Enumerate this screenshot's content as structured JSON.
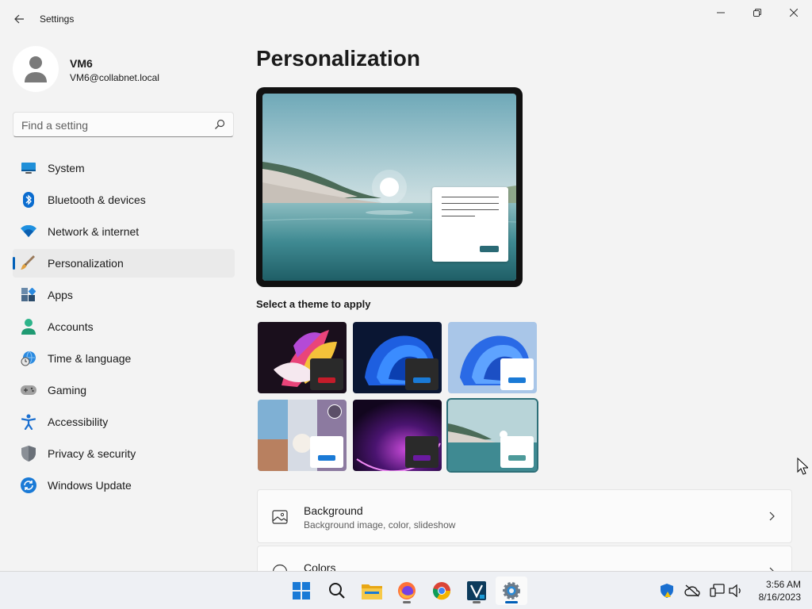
{
  "window": {
    "title": "Settings"
  },
  "user": {
    "name": "VM6",
    "email": "VM6@collabnet.local"
  },
  "search": {
    "placeholder": "Find a setting"
  },
  "nav": [
    {
      "label": "System",
      "icon": "system-icon"
    },
    {
      "label": "Bluetooth & devices",
      "icon": "bluetooth-icon"
    },
    {
      "label": "Network & internet",
      "icon": "wifi-icon"
    },
    {
      "label": "Personalization",
      "icon": "brush-icon",
      "active": true
    },
    {
      "label": "Apps",
      "icon": "apps-icon"
    },
    {
      "label": "Accounts",
      "icon": "accounts-icon"
    },
    {
      "label": "Time & language",
      "icon": "globe-clock-icon"
    },
    {
      "label": "Gaming",
      "icon": "gamepad-icon"
    },
    {
      "label": "Accessibility",
      "icon": "accessibility-icon"
    },
    {
      "label": "Privacy & security",
      "icon": "shield-icon"
    },
    {
      "label": "Windows Update",
      "icon": "windows-update-icon"
    }
  ],
  "main": {
    "title": "Personalization",
    "themes_label": "Select a theme to apply",
    "cards": [
      {
        "title": "Background",
        "subtitle": "Background image, color, slideshow",
        "icon": "image-icon"
      },
      {
        "title": "Colors",
        "subtitle": "",
        "icon": "palette-icon"
      }
    ]
  },
  "colors": {
    "accent": "#005fb8",
    "selected_theme": "#2d6f78"
  },
  "taskbar": {
    "apps": [
      "start-icon",
      "search-icon",
      "file-explorer-icon",
      "firefox-icon",
      "chrome-icon",
      "vmware-icon",
      "settings-icon"
    ],
    "time": "3:56 AM",
    "date": "8/16/2023"
  }
}
